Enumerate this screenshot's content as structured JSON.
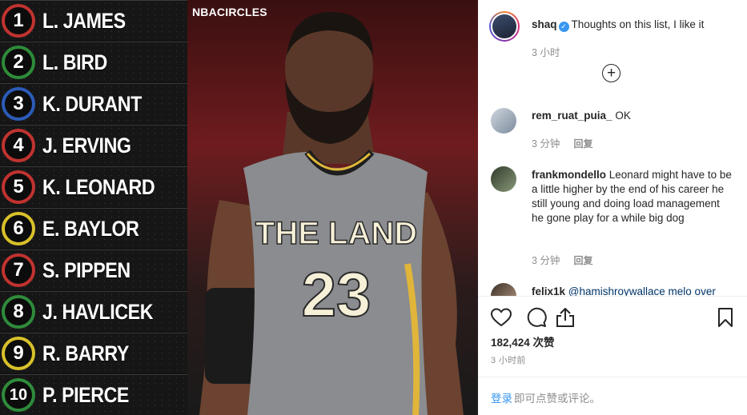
{
  "media": {
    "watermark": "NBACIRCLES",
    "rankings": [
      {
        "rank": "1",
        "name": "L. JAMES",
        "color": "#c0332f"
      },
      {
        "rank": "2",
        "name": "L. BIRD",
        "color": "#2e8b3a"
      },
      {
        "rank": "3",
        "name": "K. DURANT",
        "color": "#2c5bb8"
      },
      {
        "rank": "4",
        "name": "J. ERVING",
        "color": "#c0332f"
      },
      {
        "rank": "5",
        "name": "K. LEONARD",
        "color": "#c0332f"
      },
      {
        "rank": "6",
        "name": "E. BAYLOR",
        "color": "#d8c12a"
      },
      {
        "rank": "7",
        "name": "S. PIPPEN",
        "color": "#c0332f"
      },
      {
        "rank": "8",
        "name": "J. HAVLICEK",
        "color": "#2e8b3a"
      },
      {
        "rank": "9",
        "name": "R. BARRY",
        "color": "#d8c12a"
      },
      {
        "rank": "10",
        "name": "P. PIERCE",
        "color": "#2e8b3a"
      }
    ],
    "jersey": {
      "text": "THE LAND",
      "number": "23"
    }
  },
  "post": {
    "owner": "shaq",
    "caption": "Thoughts on this list, I like it",
    "caption_time": "3 小时",
    "load_more_icon": "plus-circle-icon",
    "comments": [
      {
        "user": "rem_ruat_puia_",
        "text": "OK",
        "time": "3 分钟",
        "reply_label": "回复"
      },
      {
        "user": "frankmondello",
        "text": "Leonard might have to be a little higher by the end of his career he still young and doing load management he gone play for a while big dog",
        "time": "3 分钟",
        "reply_label": "回复"
      },
      {
        "user": "felix1k",
        "text": "@hamishroywallace melo over"
      }
    ],
    "likes": "182,424 次赞",
    "posted_time": "3 小时前",
    "login_link": "登录",
    "login_hint": "即可点赞或评论。"
  },
  "colors": {
    "accent": "#3897f0",
    "muted": "#8e8e8e",
    "text": "#262626"
  },
  "icons": [
    "heart-icon",
    "comment-icon",
    "share-icon",
    "bookmark-icon",
    "verified-badge-icon"
  ]
}
